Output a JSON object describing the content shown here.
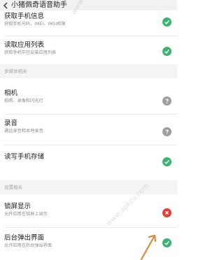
{
  "header": {
    "title": "小猪佩奇语音助手"
  },
  "sections": [
    {
      "label": ""
    },
    {
      "label": "多媒体相关"
    },
    {
      "label": "设置相关"
    }
  ],
  "items": [
    {
      "title": "获取手机信息",
      "subtitle": "获取手机号码，IMEI，IMSI权限",
      "status": "allowed"
    },
    {
      "title": "读取应用列表",
      "subtitle": "获取手机中已安装应用列表",
      "status": "allowed"
    },
    {
      "title": "相机",
      "subtitle": "拍照，录像和闪光灯",
      "status": "ask"
    },
    {
      "title": "录音",
      "subtitle": "通话录音和本地录音",
      "status": "ask"
    },
    {
      "title": "读写手机存储",
      "subtitle": "",
      "status": "allowed"
    },
    {
      "title": "锁屏显示",
      "subtitle": "允许应用在锁屏上显示",
      "status": "denied"
    },
    {
      "title": "后台弹出界面",
      "subtitle": "允许应用在后台弹出界面",
      "status": "allowed"
    }
  ],
  "status_colors": {
    "allowed": "#3cb371",
    "ask": "#9e9e9e",
    "denied": "#e0403a"
  },
  "watermark": {
    "text_1": "www.apkzu.com",
    "text_2": "www.apkzu.com"
  }
}
